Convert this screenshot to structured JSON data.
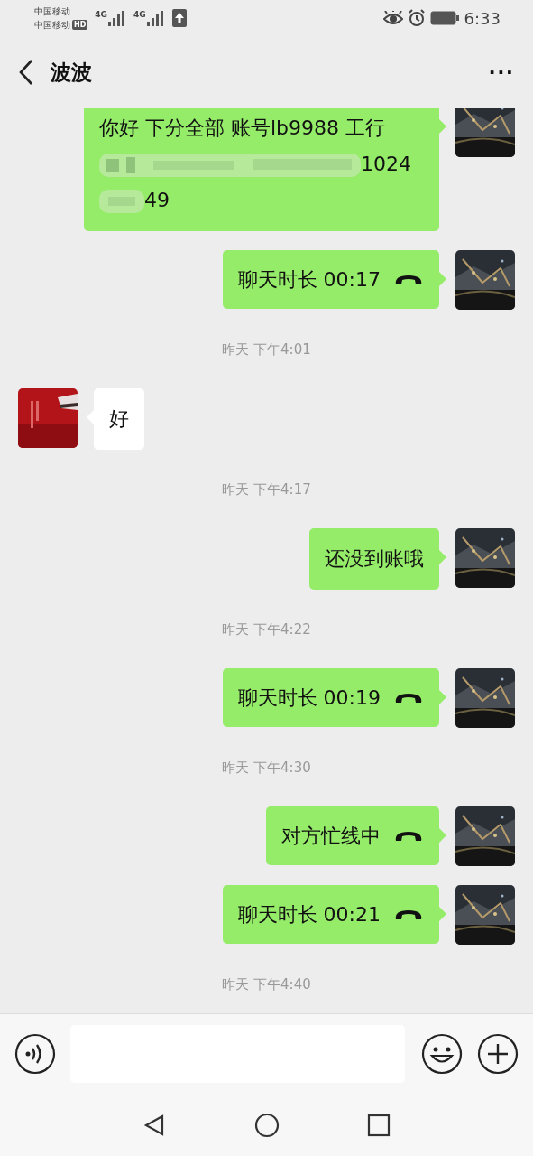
{
  "status_bar": {
    "carriers": [
      "中国移动",
      "中国移动"
    ],
    "hd_badge": "HD",
    "network_1": "4G",
    "network_2": "4G",
    "time": "6:33"
  },
  "header": {
    "title": "波波",
    "more": "···"
  },
  "messages": [
    {
      "kind": "text",
      "outgoing": true,
      "parts": [
        {
          "kind": "text",
          "text": "你好  下分全部  账号lb9988  工行"
        },
        {
          "kind": "redacted"
        },
        {
          "kind": "text",
          "text": "1024"
        },
        {
          "kind": "redacted"
        },
        {
          "kind": "text",
          "text": "49"
        }
      ]
    },
    {
      "kind": "call",
      "outgoing": true,
      "text": "聊天时长 00:17"
    },
    {
      "kind": "time",
      "text": "昨天 下午4:01"
    },
    {
      "kind": "text",
      "outgoing": false,
      "parts": [
        {
          "kind": "text",
          "text": "好"
        }
      ]
    },
    {
      "kind": "time",
      "text": "昨天 下午4:17"
    },
    {
      "kind": "text",
      "outgoing": true,
      "parts": [
        {
          "kind": "text",
          "text": "还没到账哦"
        }
      ]
    },
    {
      "kind": "time",
      "text": "昨天 下午4:22"
    },
    {
      "kind": "call",
      "outgoing": true,
      "text": "聊天时长 00:19"
    },
    {
      "kind": "time",
      "text": "昨天 下午4:30"
    },
    {
      "kind": "call",
      "outgoing": true,
      "text": "对方忙线中"
    },
    {
      "kind": "call",
      "outgoing": true,
      "text": "聊天时长 00:21"
    },
    {
      "kind": "time",
      "text": "昨天 下午4:40"
    }
  ]
}
